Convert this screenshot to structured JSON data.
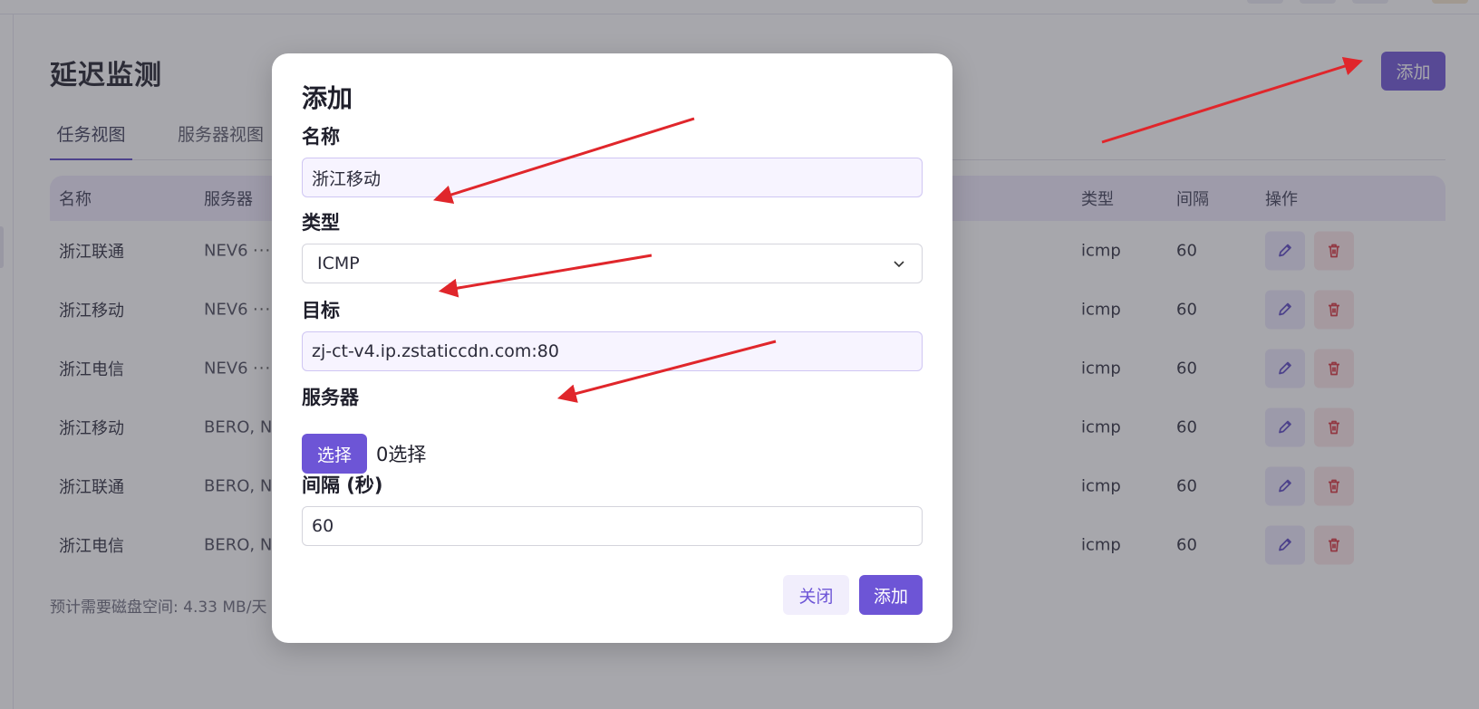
{
  "page": {
    "title": "延迟监测",
    "add_button": "添加",
    "tabs": [
      {
        "label": "任务视图",
        "active": true
      },
      {
        "label": "服务器视图",
        "active": false
      }
    ],
    "table": {
      "headers": {
        "name": "名称",
        "server": "服务器",
        "type": "类型",
        "interval": "间隔",
        "ops": "操作"
      },
      "rows": [
        {
          "name": "浙江联通",
          "server": "NEV6",
          "more": "···",
          "type": "icmp",
          "interval": "60"
        },
        {
          "name": "浙江移动",
          "server": "NEV6",
          "more": "···",
          "type": "icmp",
          "interval": "60"
        },
        {
          "name": "浙江电信",
          "server": "NEV6",
          "more": "···",
          "type": "icmp",
          "interval": "60"
        },
        {
          "name": "浙江移动",
          "server": "BERO, NE",
          "more": "",
          "type": "icmp",
          "interval": "60"
        },
        {
          "name": "浙江联通",
          "server": "BERO, NE",
          "more": "",
          "type": "icmp",
          "interval": "60"
        },
        {
          "name": "浙江电信",
          "server": "BERO, NE",
          "more": "",
          "type": "icmp",
          "interval": "60"
        }
      ]
    },
    "footnote": "预计需要磁盘空间: 4.33 MB/天"
  },
  "modal": {
    "title": "添加",
    "name_label": "名称",
    "name_value": "浙江移动",
    "type_label": "类型",
    "type_value": "ICMP",
    "target_label": "目标",
    "target_value": "zj-ct-v4.ip.zstaticcdn.com:80",
    "server_label": "服务器",
    "select_button": "选择",
    "selected_count": "0选择",
    "interval_label": "间隔 (秒)",
    "interval_value": "60",
    "close_button": "关闭",
    "add_button": "添加"
  },
  "colors": {
    "accent": "#6d55d6",
    "arrow": "#e0262b",
    "danger": "#d9363e"
  },
  "icons": {
    "edit": "pencil-icon",
    "delete": "trash-icon",
    "dropdown": "chevron-down-icon"
  }
}
